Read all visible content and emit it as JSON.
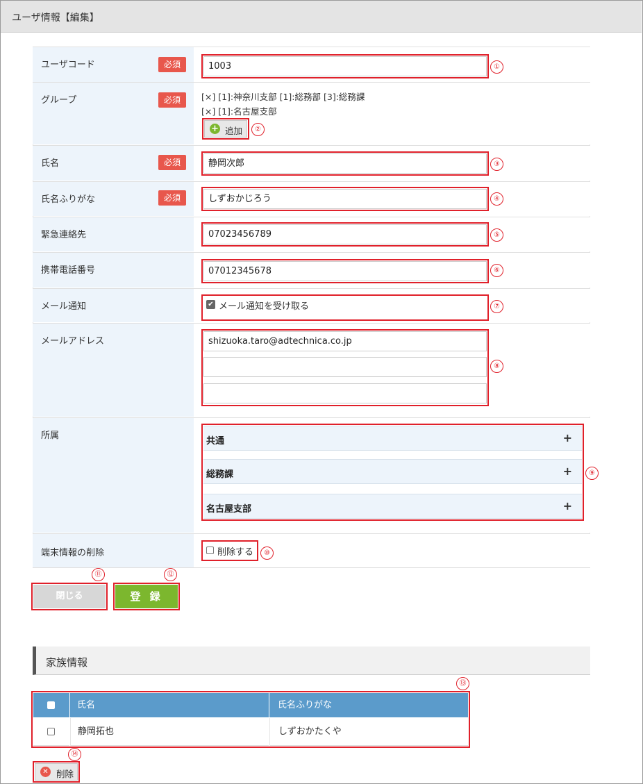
{
  "header": {
    "title": "ユーザ情報【編集】"
  },
  "form": {
    "required_label": "必須",
    "user_code": {
      "label": "ユーザコード",
      "value": "1003"
    },
    "group": {
      "label": "グループ",
      "lines": [
        "[×] [1]:神奈川支部 [1]:総務部 [3]:総務課",
        "[×] [1]:名古屋支部"
      ],
      "add_label": "追加"
    },
    "name": {
      "label": "氏名",
      "value": "静岡次郎"
    },
    "name_kana": {
      "label": "氏名ふりがな",
      "value": "しずおかじろう"
    },
    "emergency": {
      "label": "緊急連絡先",
      "value": "07023456789"
    },
    "mobile": {
      "label": "携帯電話番号",
      "value": "07012345678"
    },
    "mail_notify": {
      "label": "メール通知",
      "checkbox_label": "メール通知を受け取る",
      "checked": true
    },
    "mail_address": {
      "label": "メールアドレス",
      "values": [
        "shizuoka.taro@adtechnica.co.jp",
        "",
        ""
      ]
    },
    "affiliation": {
      "label": "所属",
      "items": [
        "共通",
        "総務課",
        "名古屋支部"
      ],
      "expand_symbol": "+"
    },
    "device_delete": {
      "label": "端末情報の削除",
      "checkbox_label": "削除する",
      "checked": false
    }
  },
  "buttons": {
    "close": "閉じる",
    "register": "登 録"
  },
  "family": {
    "title": "家族情報",
    "columns": [
      "氏名",
      "氏名ふりがな"
    ],
    "rows": [
      {
        "name": "静岡拓也",
        "kana": "しずおかたくや"
      }
    ],
    "delete_label": "削除"
  },
  "annotations": [
    "①",
    "②",
    "③",
    "④",
    "⑤",
    "⑥",
    "⑦",
    "⑧",
    "⑨",
    "⑩",
    "⑪",
    "⑫",
    "⑬",
    "⑭"
  ],
  "colors": {
    "required": "#e8574c",
    "highlight": "#e0202a",
    "register": "#7cb72e",
    "table_header": "#5b9bcb",
    "label_bg": "#edf4fb"
  }
}
